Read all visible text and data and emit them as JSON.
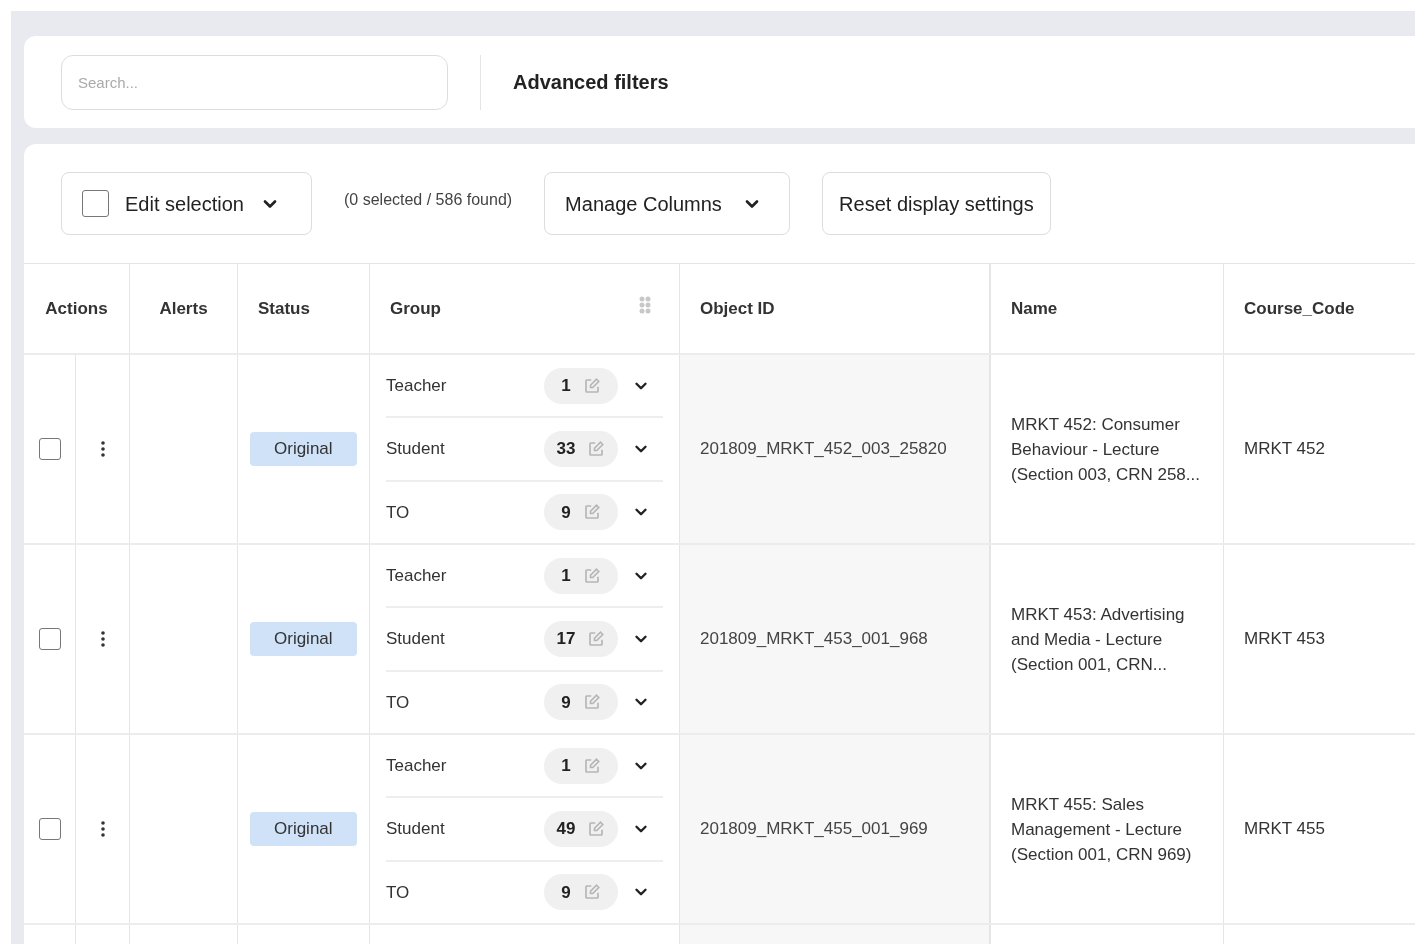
{
  "search": {
    "placeholder": "Search..."
  },
  "advanced_filters": "Advanced filters",
  "toolbar": {
    "edit_selection": {
      "label": "Edit selection",
      "checked": false
    },
    "count": "(0 selected / 586 found)",
    "manage_columns": "Manage Columns",
    "reset": "Reset display settings"
  },
  "columns": [
    "Actions",
    "Alerts",
    "Status",
    "Group",
    "Object ID",
    "Name",
    "Course_Code"
  ],
  "rows": [
    {
      "checked": false,
      "status": "Original",
      "groups": [
        {
          "label": "Teacher",
          "count": "1"
        },
        {
          "label": "Student",
          "count": "33"
        },
        {
          "label": "TO",
          "count": "9"
        }
      ],
      "object_id": "201809_MRKT_452_003_25820",
      "name": "MRKT 452: Consumer Behaviour - Lecture (Section 003, CRN 258...",
      "course_code": "MRKT 452"
    },
    {
      "checked": false,
      "status": "Original",
      "groups": [
        {
          "label": "Teacher",
          "count": "1"
        },
        {
          "label": "Student",
          "count": "17"
        },
        {
          "label": "TO",
          "count": "9"
        }
      ],
      "object_id": "201809_MRKT_453_001_968",
      "name": "MRKT 453: Advertising and Media - Lecture (Section 001, CRN...",
      "course_code": "MRKT 453"
    },
    {
      "checked": false,
      "status": "Original",
      "groups": [
        {
          "label": "Teacher",
          "count": "1"
        },
        {
          "label": "Student",
          "count": "49"
        },
        {
          "label": "TO",
          "count": "9"
        }
      ],
      "object_id": "201809_MRKT_455_001_969",
      "name": "MRKT 455: Sales Management - Lecture (Section 001, CRN 969)",
      "course_code": "MRKT 455"
    }
  ]
}
